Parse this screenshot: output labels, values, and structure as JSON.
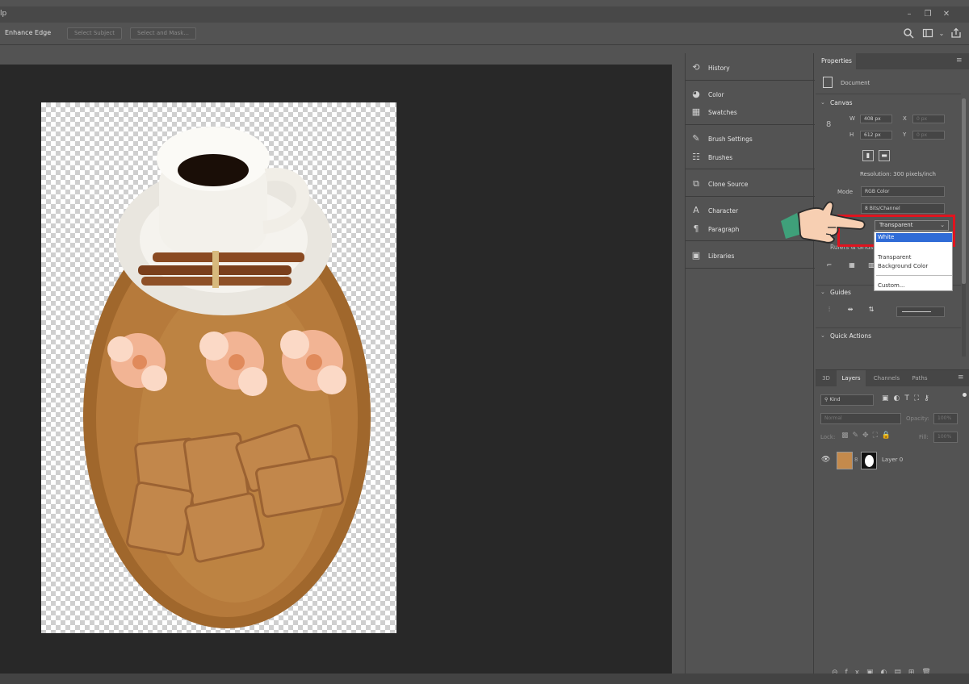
{
  "titlebar": {
    "title_fragment": "lp"
  },
  "options_bar": {
    "enhance_edge": "Enhance Edge",
    "select_subject": "Select Subject",
    "select_and_mask": "Select and Mask..."
  },
  "dock": {
    "items": [
      {
        "label": "History",
        "icon": "history-icon"
      },
      {
        "label": "Color",
        "icon": "color-icon"
      },
      {
        "label": "Swatches",
        "icon": "swatches-icon"
      },
      {
        "label": "Brush Settings",
        "icon": "brush-settings-icon"
      },
      {
        "label": "Brushes",
        "icon": "brushes-icon"
      },
      {
        "label": "Clone Source",
        "icon": "clone-source-icon"
      },
      {
        "label": "Character",
        "icon": "character-icon"
      },
      {
        "label": "Paragraph",
        "icon": "paragraph-icon"
      },
      {
        "label": "Libraries",
        "icon": "libraries-icon"
      }
    ]
  },
  "properties": {
    "tab": "Properties",
    "document": "Document",
    "canvas_title": "Canvas",
    "w_label": "W",
    "w_value": "408 px",
    "h_label": "H",
    "h_value": "612 px",
    "x_label": "X",
    "x_value": "0 px",
    "y_label": "Y",
    "y_value": "0 px",
    "resolution": "Resolution: 300 pixels/inch",
    "mode_label": "Mode",
    "mode_value": "RGB Color",
    "depth_value": "8 Bits/Channel",
    "background_value": "Transparent",
    "rulers_title": "Rulers & Grids",
    "guides_title": "Guides",
    "quick_actions_title": "Quick Actions"
  },
  "bg_menu": {
    "items": [
      "White",
      "Transparent",
      "Background Color",
      "Custom..."
    ],
    "selected": "White"
  },
  "layers": {
    "tabs": [
      "3D",
      "Layers",
      "Channels",
      "Paths"
    ],
    "active_tab": "Layers",
    "filter_kind": "Kind",
    "blend_mode": "Normal",
    "opacity_label": "Opacity:",
    "opacity_value": "100%",
    "lock_label": "Lock:",
    "fill_label": "Fill:",
    "fill_value": "100%",
    "layer_name": "Layer 0"
  },
  "colors": {
    "highlight": "#e0141f",
    "menu_selection": "#2f6bd6",
    "canvas_bg": "#282828",
    "panel_bg": "#535353"
  }
}
